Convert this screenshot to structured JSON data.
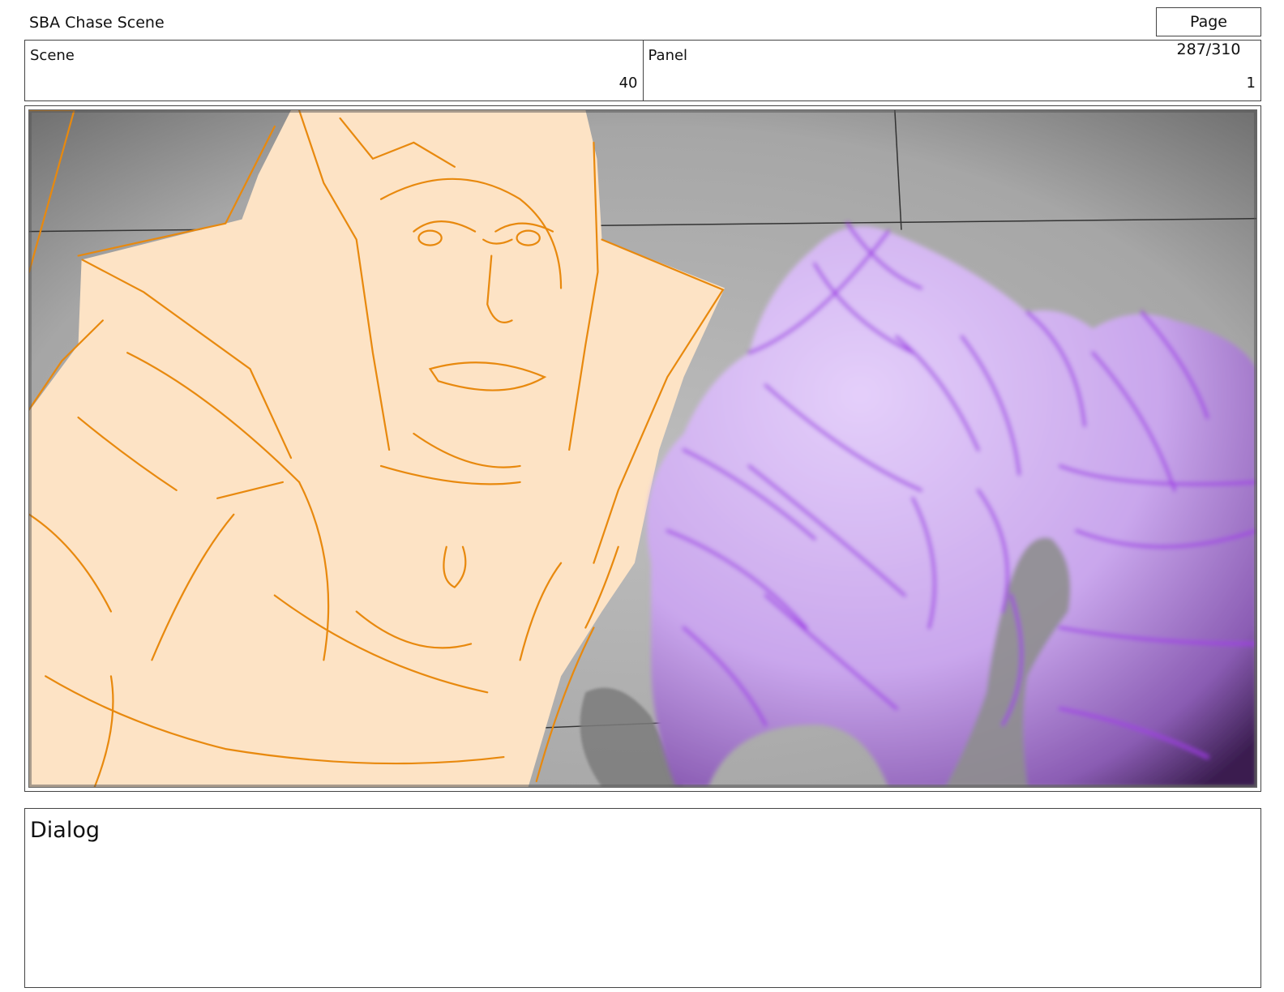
{
  "header": {
    "project_title": "SBA Chase Scene",
    "page_indicator": "Page 287/310"
  },
  "info": {
    "scene_label": "Scene",
    "scene_number": "40",
    "panel_label": "Panel",
    "panel_number": "1"
  },
  "frame": {
    "colors": {
      "background": "#b4b4b4",
      "character_fill": "#fde3c5",
      "character_line": "#e8890e",
      "fist_fill": "#dcc3f7",
      "fist_line": "#a13ce6",
      "vignette_dark": "#3a1d4f"
    }
  },
  "dialog": {
    "label": "Dialog",
    "text": ""
  }
}
